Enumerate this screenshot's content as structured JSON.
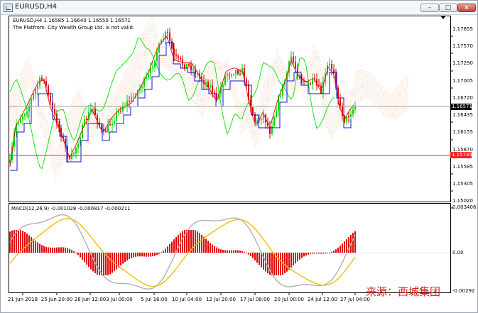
{
  "window": {
    "title": "EURUSD,H4"
  },
  "chart_header": {
    "symbol_line": "EURUSD,H4  1.16585 1.16640 1.16550 1.16571",
    "notice": "The Platfrom. City Wealth Group Ltd. is not valid."
  },
  "macd_header": "MACD(12,26,9) -0.001028 -0.000817 -0.000211",
  "watermark": "来源：西城集团",
  "colors": {
    "bull": "#00d800",
    "bear": "#e00000",
    "kijun": "#1010d8",
    "tenkan": "#e01010",
    "chikou": "#00e000",
    "cloud": "#f0a070",
    "current_line": "#a0a0a0",
    "level_line": "#ff2020",
    "macd_signal": "#f0c000",
    "macd_line": "#b0b0b0"
  },
  "chart_data": [
    {
      "type": "candlestick",
      "title": "EURUSD,H4",
      "indicators": [
        "Ichimoku cloud",
        "Tenkan-sen",
        "Kijun-sen",
        "Chikou span"
      ],
      "y_ticks": [
        "1.17855",
        "1.17570",
        "1.17290",
        "1.17005",
        "1.16720",
        "1.16435",
        "1.16155",
        "1.15870",
        "1.15585",
        "1.15305",
        "1.15020"
      ],
      "ylim": [
        1.1502,
        1.17855
      ],
      "current_price": "1.16571",
      "horizontal_level": "1.15745",
      "last_bar": {
        "open": 1.16585,
        "high": 1.1664,
        "low": 1.1655,
        "close": 1.16571
      },
      "x_ticks": [
        "21 Jun 2018",
        "25 Jun 20:00",
        "28 Jun 12:00",
        "3 Jul 00:00",
        "5 Jul 16:00",
        "10 Jul 04:00",
        "12 Jul 20:00",
        "17 Jul 08:00",
        "20 Jul 00:00",
        "24 Jul 12:00",
        "27 Jul 04:00"
      ]
    },
    {
      "type": "bar",
      "title": "MACD(12,26,9)",
      "y_ticks": [
        "0.003406",
        "0.00",
        "-0.00292"
      ],
      "ylim": [
        -0.00292,
        0.003406
      ],
      "last_values": {
        "macd": -0.001028,
        "signal": -0.000817,
        "histogram": -0.000211
      }
    }
  ]
}
